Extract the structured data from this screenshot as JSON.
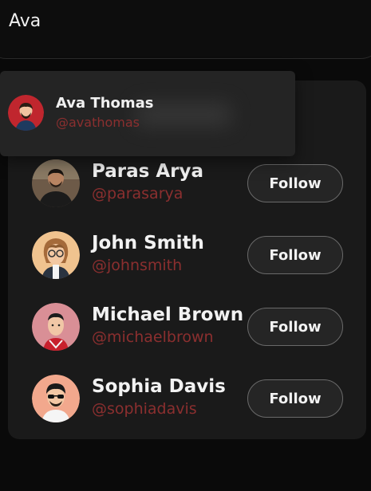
{
  "search": {
    "query": "Ava"
  },
  "suggestion": {
    "name": "Ava Thomas",
    "handle": "@avathomas"
  },
  "people": [
    {
      "name": "Paras Arya",
      "handle": "@parasarya",
      "follow_label": "Follow"
    },
    {
      "name": "John Smith",
      "handle": "@johnsmith",
      "follow_label": "Follow"
    },
    {
      "name": "Michael Brown",
      "handle": "@michaelbrown",
      "follow_label": "Follow"
    },
    {
      "name": "Sophia Davis",
      "handle": "@sophiadavis",
      "follow_label": "Follow"
    }
  ],
  "colors": {
    "accent_handle": "#8b2f2f",
    "panel": "#1a1a1a",
    "background": "#0a0a0a"
  }
}
